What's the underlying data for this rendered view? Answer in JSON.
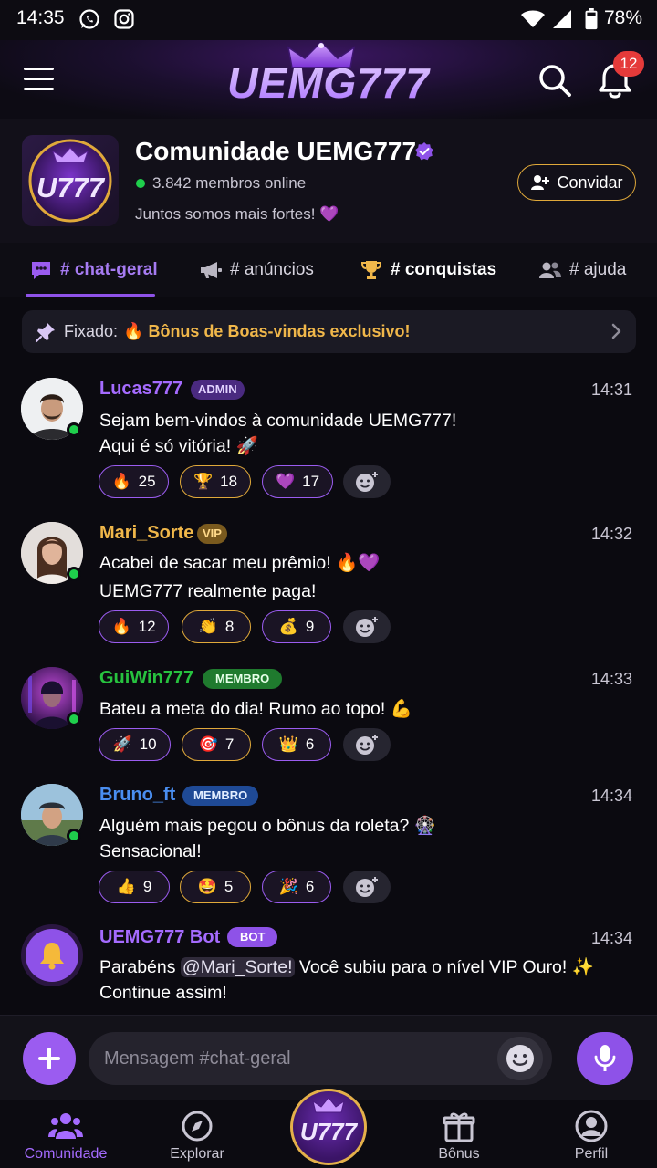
{
  "status_bar": {
    "time": "14:35",
    "battery": "78%"
  },
  "header": {
    "logo_text": "UEMG777",
    "notification_count": "12"
  },
  "community": {
    "name": "Comunidade UEMG777",
    "online": "3.842 membros online",
    "tagline": "Juntos somos mais fortes! 💜",
    "invite_label": "Convidar",
    "logo_text": "U777"
  },
  "tabs": [
    {
      "label": "# chat-geral",
      "icon": "chat-bubble-icon",
      "active": true
    },
    {
      "label": "# anúncios",
      "icon": "megaphone-icon",
      "active": false
    },
    {
      "label": "# conquistas",
      "icon": "trophy-icon",
      "active": false
    },
    {
      "label": "# ajuda",
      "icon": "users-icon",
      "active": false
    }
  ],
  "pinned": {
    "label": "Fixado:",
    "text": "🔥 Bônus de Boas-vindas exclusivo!"
  },
  "messages": [
    {
      "user": "Lucas777",
      "role": "ADMIN",
      "time": "14:31",
      "lines": [
        "Sejam bem-vindos à comunidade UEMG777!",
        "Aqui é só vitória! 🚀"
      ],
      "reactions": [
        {
          "emoji": "🔥",
          "count": "25"
        },
        {
          "emoji": "🏆",
          "count": "18"
        },
        {
          "emoji": "💜",
          "count": "17"
        }
      ]
    },
    {
      "user": "Mari_Sorte",
      "role": "VIP",
      "time": "14:32",
      "lines": [
        "Acabei de sacar meu prêmio! 🔥💜",
        "UEMG777 realmente paga!"
      ],
      "reactions": [
        {
          "emoji": "🔥",
          "count": "12"
        },
        {
          "emoji": "👏",
          "count": "8"
        },
        {
          "emoji": "💰",
          "count": "9"
        }
      ]
    },
    {
      "user": "GuiWin777",
      "role": "MEMBRO",
      "time": "14:33",
      "lines": [
        "Bateu a meta do dia! Rumo ao topo! 💪"
      ],
      "reactions": [
        {
          "emoji": "🚀",
          "count": "10"
        },
        {
          "emoji": "🎯",
          "count": "7"
        },
        {
          "emoji": "👑",
          "count": "6"
        }
      ]
    },
    {
      "user": "Bruno_ft",
      "role": "MEMBRO",
      "time": "14:34",
      "lines": [
        "Alguém mais pegou o bônus da roleta? 🎡",
        "Sensacional!"
      ],
      "reactions": [
        {
          "emoji": "👍",
          "count": "9"
        },
        {
          "emoji": "🤩",
          "count": "5"
        },
        {
          "emoji": "🎉",
          "count": "6"
        }
      ]
    },
    {
      "user": "UEMG777 Bot",
      "role": "BOT",
      "time": "14:34",
      "text_before": "Parabéns ",
      "mention": "@Mari_Sorte!",
      "text_after": " Você subiu para o nível VIP Ouro! ✨",
      "line2": "Continue assim!"
    }
  ],
  "composer": {
    "placeholder": "Mensagem #chat-geral"
  },
  "bottom_nav": [
    {
      "label": "Comunidade",
      "icon": "community-icon",
      "active": true
    },
    {
      "label": "Explorar",
      "icon": "compass-icon",
      "active": false
    },
    {
      "label": "Bônus",
      "icon": "gift-icon",
      "active": false
    },
    {
      "label": "Perfil",
      "icon": "profile-icon",
      "active": false
    }
  ],
  "colors": {
    "accent": "#8e52e8",
    "gold": "#e0a93a",
    "online": "#1fcf4c",
    "admin": "#a56bff",
    "vip": "#f0b74a",
    "member_green": "#27c23f",
    "member_blue": "#4a8ef0"
  }
}
